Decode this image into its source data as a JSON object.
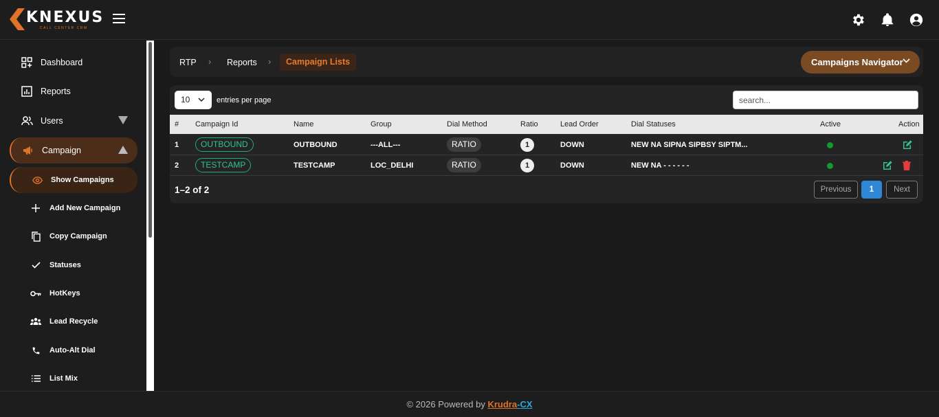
{
  "brand": {
    "name": "KNEXUS",
    "tagline": "CALL CENTER CRM"
  },
  "colors": {
    "accent": "#e0732a",
    "active_green": "#149a2c",
    "primary_blue": "#2f87d6"
  },
  "sidebar": {
    "items": [
      {
        "label": "Dashboard",
        "icon": "dashboard-icon"
      },
      {
        "label": "Reports",
        "icon": "reports-icon"
      },
      {
        "label": "Users",
        "icon": "users-icon"
      },
      {
        "label": "Campaign",
        "icon": "megaphone-icon"
      }
    ],
    "subitems": [
      {
        "label": "Show Campaigns",
        "icon": "eye-icon"
      },
      {
        "label": "Add New Campaign",
        "icon": "plus-icon"
      },
      {
        "label": "Copy Campaign",
        "icon": "copy-icon"
      },
      {
        "label": "Statuses",
        "icon": "check-icon"
      },
      {
        "label": "HotKeys",
        "icon": "key-icon"
      },
      {
        "label": "Lead Recycle",
        "icon": "group-icon"
      },
      {
        "label": "Auto-Alt Dial",
        "icon": "phone-icon"
      },
      {
        "label": "List Mix",
        "icon": "list-icon"
      }
    ]
  },
  "breadcrumb": {
    "items": [
      "RTP",
      "Reports",
      "Campaign Lists"
    ],
    "navigator_label": "Campaigns Navigator"
  },
  "table": {
    "page_size": "10",
    "entries_label": "entries per page",
    "search_placeholder": "search...",
    "headers": [
      "#",
      "Campaign Id",
      "Name",
      "Group",
      "Dial Method",
      "Ratio",
      "Lead Order",
      "Dial Statuses",
      "Active",
      "Action"
    ],
    "rows": [
      {
        "num": "1",
        "id": "OUTBOUND",
        "name": "OUTBOUND",
        "group": "---ALL---",
        "dial": "RATIO",
        "ratio": "1",
        "lead_order": "DOWN",
        "statuses": "NEW NA SIPNA SIPBSY SIPTM..."
      },
      {
        "num": "2",
        "id": "TESTCAMP",
        "name": "TESTCAMP",
        "group": "LOC_DELHI",
        "dial": "RATIO",
        "ratio": "1",
        "lead_order": "DOWN",
        "statuses": "NEW NA - - - - - -"
      }
    ],
    "pagination": {
      "info": "1–2 of 2",
      "previous": "Previous",
      "current": "1",
      "next": "Next"
    }
  },
  "footer": {
    "text": "© 2026 Powered by ",
    "brand1": "Krudra",
    "sep": "-",
    "brand2": "CX"
  }
}
